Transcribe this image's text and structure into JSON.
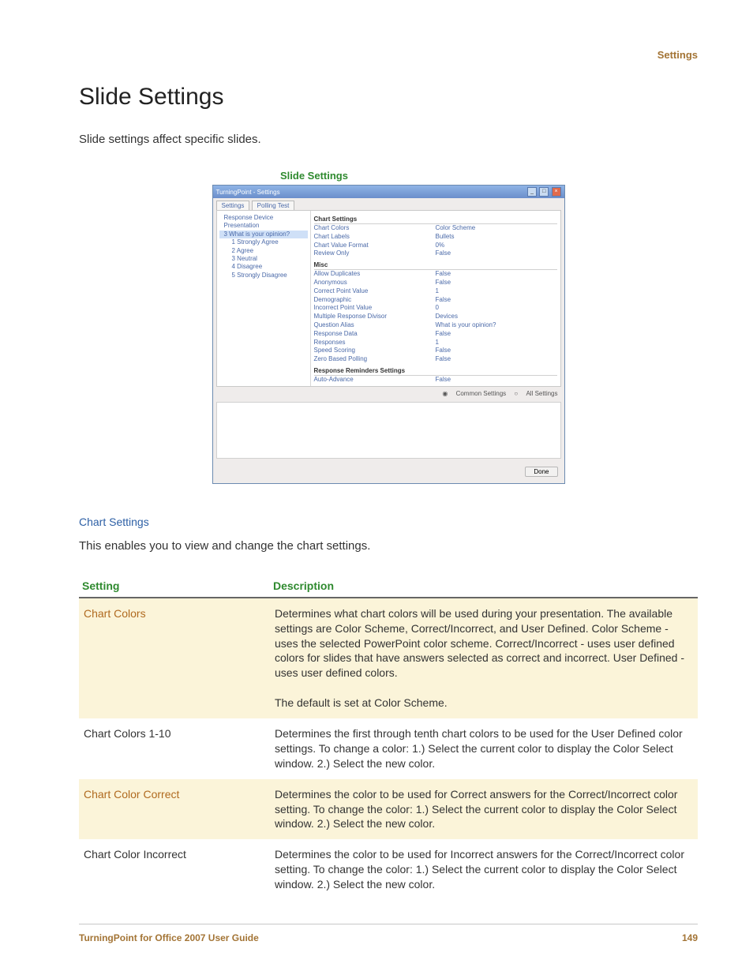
{
  "header": {
    "section": "Settings"
  },
  "page": {
    "title": "Slide Settings",
    "intro": "Slide settings affect specific slides.",
    "caption": "Slide Settings"
  },
  "screenshot": {
    "windowTitle": "TurningPoint - Settings",
    "tabs": [
      "Settings",
      "Polling Test"
    ],
    "tree": [
      {
        "label": "Response Device",
        "cls": "indent1"
      },
      {
        "label": "Presentation",
        "cls": "indent1"
      },
      {
        "label": "3  What is your opinion?",
        "cls": "indent1 sel"
      },
      {
        "label": "1  Strongly Agree",
        "cls": "indent2"
      },
      {
        "label": "2  Agree",
        "cls": "indent2"
      },
      {
        "label": "3  Neutral",
        "cls": "indent2"
      },
      {
        "label": "4  Disagree",
        "cls": "indent2"
      },
      {
        "label": "5  Strongly Disagree",
        "cls": "indent2"
      }
    ],
    "groups": [
      {
        "title": "Chart Settings",
        "rows": [
          {
            "k": "Chart Colors",
            "v": "Color Scheme"
          },
          {
            "k": "Chart Labels",
            "v": "Bullets"
          },
          {
            "k": "Chart Value Format",
            "v": "0%"
          },
          {
            "k": "Review Only",
            "v": "False"
          }
        ]
      },
      {
        "title": "Misc",
        "rows": [
          {
            "k": "Allow Duplicates",
            "v": "False"
          },
          {
            "k": "Anonymous",
            "v": "False"
          },
          {
            "k": "Correct Point Value",
            "v": "1"
          },
          {
            "k": "Demographic",
            "v": "False"
          },
          {
            "k": "Incorrect Point Value",
            "v": "0"
          },
          {
            "k": "Multiple Response Divisor",
            "v": "Devices"
          },
          {
            "k": "Question Alias",
            "v": "What is your opinion?"
          },
          {
            "k": "Response Data",
            "v": "False"
          },
          {
            "k": "Responses",
            "v": "1"
          },
          {
            "k": "Speed Scoring",
            "v": "False"
          },
          {
            "k": "Zero Based Polling",
            "v": "False"
          }
        ]
      },
      {
        "title": "Response Reminders Settings",
        "rows": [
          {
            "k": "Auto-Advance",
            "v": "False"
          }
        ]
      }
    ],
    "radios": {
      "common": "Common Settings",
      "all": "All Settings"
    },
    "done": "Done"
  },
  "subsection": {
    "title": "Chart Settings",
    "lead": "This enables you to view and change the chart settings."
  },
  "table": {
    "head": {
      "setting": "Setting",
      "description": "Description"
    },
    "rows": [
      {
        "hl": true,
        "name": "Chart Colors",
        "desc": "Determines what chart colors will be used during your presentation. The available settings are Color Scheme, Correct/Incorrect, and User Defined. Color Scheme - uses the selected PowerPoint color scheme. Correct/Incorrect - uses user defined colors for slides that have answers selected as correct and incorrect. User Defined - uses user defined colors.\n\nThe default is set at Color Scheme."
      },
      {
        "hl": false,
        "name": "Chart Colors 1-10",
        "desc": "Determines the first through tenth chart colors to be used for the User Defined color settings. To change a color: 1.) Select the current color to display the Color Select window. 2.) Select the new color."
      },
      {
        "hl": true,
        "name": "Chart Color Correct",
        "desc": "Determines the color to be used for Correct answers for the Correct/Incorrect color setting. To change the color: 1.) Select the current color to display the Color Select window. 2.) Select the new color."
      },
      {
        "hl": false,
        "name": "Chart Color Incorrect",
        "desc": "Determines the color to be used for Incorrect answers for the Correct/Incorrect color setting. To change the color: 1.) Select the current color to display the Color Select window. 2.) Select the new color."
      }
    ]
  },
  "footer": {
    "left": "TurningPoint for Office 2007 User Guide",
    "right": "149"
  }
}
